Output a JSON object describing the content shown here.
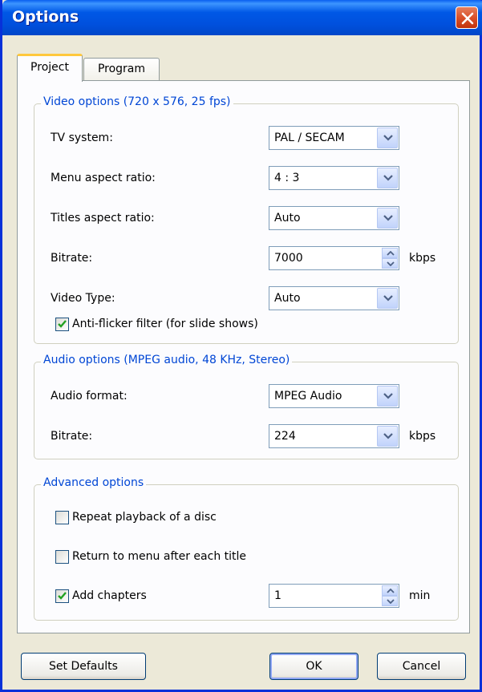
{
  "window": {
    "title": "Options"
  },
  "tabs": [
    {
      "label": "Project"
    },
    {
      "label": "Program"
    }
  ],
  "video": {
    "legend": "Video options (720 x 576, 25 fps)",
    "tv_system": {
      "label": "TV system:",
      "value": "PAL / SECAM"
    },
    "menu_aspect": {
      "label": "Menu aspect ratio:",
      "value": "4 : 3"
    },
    "titles_aspect": {
      "label": "Titles aspect ratio:",
      "value": "Auto"
    },
    "bitrate": {
      "label": "Bitrate:",
      "value": "7000",
      "unit": "kbps"
    },
    "video_type": {
      "label": "Video Type:",
      "value": "Auto"
    },
    "anti_flicker": {
      "label": "Anti-flicker filter (for slide shows)",
      "checked": true
    }
  },
  "audio": {
    "legend": "Audio options (MPEG audio, 48 KHz, Stereo)",
    "format": {
      "label": "Audio format:",
      "value": "MPEG Audio"
    },
    "bitrate": {
      "label": "Bitrate:",
      "value": "224",
      "unit": "kbps"
    }
  },
  "advanced": {
    "legend": "Advanced options",
    "repeat": {
      "label": "Repeat playback of a disc",
      "checked": false
    },
    "return_menu": {
      "label": "Return to menu after each title",
      "checked": false
    },
    "chapters": {
      "label": "Add chapters",
      "checked": true,
      "value": "1",
      "unit": "min"
    }
  },
  "buttons": {
    "set_defaults": "Set Defaults",
    "ok": "OK",
    "cancel": "Cancel"
  },
  "icons": {
    "close": "close-icon",
    "dropdown": "chevron-down-icon",
    "check": "checkmark-icon"
  },
  "colors": {
    "titlebar": "#0058e6",
    "legend": "#0046d5",
    "tab_highlight": "#ffc83c"
  }
}
